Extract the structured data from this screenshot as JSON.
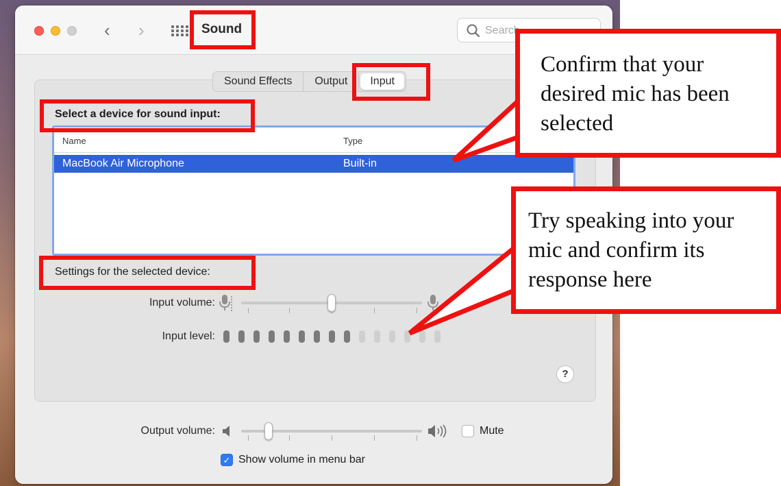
{
  "window": {
    "title": "Sound",
    "search_placeholder": "Search"
  },
  "tabs": [
    {
      "label": "Sound Effects",
      "selected": false
    },
    {
      "label": "Output",
      "selected": false
    },
    {
      "label": "Input",
      "selected": true
    }
  ],
  "input_section": {
    "heading": "Select a device for sound input:",
    "columns": [
      "Name",
      "Type"
    ],
    "rows": [
      {
        "name": "MacBook Air Microphone",
        "type": "Built-in",
        "selected": true
      }
    ]
  },
  "settings_section": {
    "heading": "Settings for the selected device:",
    "input_volume_label": "Input volume:",
    "input_volume": 0.5,
    "input_level_label": "Input level:",
    "input_level_active": 9,
    "input_level_total": 15
  },
  "help_label": "?",
  "output": {
    "volume_label": "Output volume:",
    "volume": 0.15,
    "mute_label": "Mute",
    "mute_checked": false,
    "show_in_menu_bar_label": "Show volume in menu bar",
    "show_in_menu_bar_checked": true
  },
  "annotations": {
    "callout_1": [
      "Confirm that your",
      "desired mic has been",
      "selected"
    ],
    "callout_2": [
      "Try speaking into your",
      "mic and confirm its",
      "response here"
    ]
  },
  "colors": {
    "selection": "#2f62d8",
    "annotation": "#ee1111",
    "checkbox": "#2f7bf5"
  }
}
